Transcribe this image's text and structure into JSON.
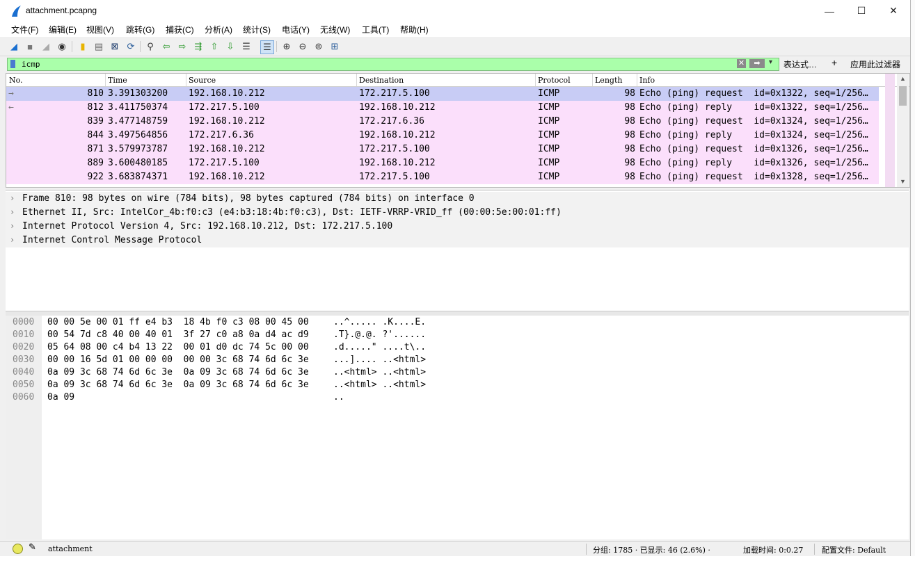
{
  "window": {
    "title": "attachment.pcapng",
    "minimize": "—",
    "maximize": "☐",
    "close": "✕"
  },
  "menu": [
    "文件(F)",
    "编辑(E)",
    "视图(V)",
    "跳转(G)",
    "捕获(C)",
    "分析(A)",
    "统计(S)",
    "电话(Y)",
    "无线(W)",
    "工具(T)",
    "帮助(H)"
  ],
  "filter": {
    "value": "icmp",
    "expression_label": "表达式…",
    "plus": "+",
    "apply_label": "应用此过滤器"
  },
  "columns": [
    "No.",
    "Time",
    "Source",
    "Destination",
    "Protocol",
    "Length",
    "Info"
  ],
  "packets": [
    {
      "no": "810",
      "time": "3.391303200",
      "src": "192.168.10.212",
      "dst": "172.217.5.100",
      "proto": "ICMP",
      "len": "98",
      "info": "Echo (ping) request  id=0x1322, seq=1/256…",
      "selected": true,
      "dir": "→"
    },
    {
      "no": "812",
      "time": "3.411750374",
      "src": "172.217.5.100",
      "dst": "192.168.10.212",
      "proto": "ICMP",
      "len": "98",
      "info": "Echo (ping) reply    id=0x1322, seq=1/256…",
      "selected": false,
      "dir": "←"
    },
    {
      "no": "839",
      "time": "3.477148759",
      "src": "192.168.10.212",
      "dst": "172.217.6.36",
      "proto": "ICMP",
      "len": "98",
      "info": "Echo (ping) request  id=0x1324, seq=1/256…",
      "selected": false,
      "dir": ""
    },
    {
      "no": "844",
      "time": "3.497564856",
      "src": "172.217.6.36",
      "dst": "192.168.10.212",
      "proto": "ICMP",
      "len": "98",
      "info": "Echo (ping) reply    id=0x1324, seq=1/256…",
      "selected": false,
      "dir": ""
    },
    {
      "no": "871",
      "time": "3.579973787",
      "src": "192.168.10.212",
      "dst": "172.217.5.100",
      "proto": "ICMP",
      "len": "98",
      "info": "Echo (ping) request  id=0x1326, seq=1/256…",
      "selected": false,
      "dir": ""
    },
    {
      "no": "889",
      "time": "3.600480185",
      "src": "172.217.5.100",
      "dst": "192.168.10.212",
      "proto": "ICMP",
      "len": "98",
      "info": "Echo (ping) reply    id=0x1326, seq=1/256…",
      "selected": false,
      "dir": ""
    },
    {
      "no": "922",
      "time": "3.683874371",
      "src": "192.168.10.212",
      "dst": "172.217.5.100",
      "proto": "ICMP",
      "len": "98",
      "info": "Echo (ping) request  id=0x1328, seq=1/256…",
      "selected": false,
      "dir": ""
    }
  ],
  "details": [
    "Frame 810: 98 bytes on wire (784 bits), 98 bytes captured (784 bits) on interface 0",
    "Ethernet II, Src: IntelCor_4b:f0:c3 (e4:b3:18:4b:f0:c3), Dst: IETF-VRRP-VRID_ff (00:00:5e:00:01:ff)",
    "Internet Protocol Version 4, Src: 192.168.10.212, Dst: 172.217.5.100",
    "Internet Control Message Protocol"
  ],
  "bytes": [
    {
      "off": "0000",
      "hex": "00 00 5e 00 01 ff e4 b3  18 4b f0 c3 08 00 45 00",
      "ascii": "..^..... .K....E."
    },
    {
      "off": "0010",
      "hex": "00 54 7d c8 40 00 40 01  3f 27 c0 a8 0a d4 ac d9",
      "ascii": ".T}.@.@. ?'......"
    },
    {
      "off": "0020",
      "hex": "05 64 08 00 c4 b4 13 22  00 01 d0 dc 74 5c 00 00",
      "ascii": ".d.....\" ....t\\.."
    },
    {
      "off": "0030",
      "hex": "00 00 16 5d 01 00 00 00  00 00 3c 68 74 6d 6c 3e",
      "ascii": "...].... ..<html>"
    },
    {
      "off": "0040",
      "hex": "0a 09 3c 68 74 6d 6c 3e  0a 09 3c 68 74 6d 6c 3e",
      "ascii": "..<html> ..<html>"
    },
    {
      "off": "0050",
      "hex": "0a 09 3c 68 74 6d 6c 3e  0a 09 3c 68 74 6d 6c 3e",
      "ascii": "..<html> ..<html>"
    },
    {
      "off": "0060",
      "hex": "0a 09",
      "ascii": ".."
    }
  ],
  "status": {
    "file": "attachment",
    "packets": "分组: 1785 · 已显示: 46 (2.6%) ·",
    "load": "加载时间: 0:0.27",
    "profile": "配置文件: Default"
  },
  "colors": {
    "row_bg": "#fbdffb",
    "selected_bg": "#c8ccf5",
    "filter_ok": "#aaffaa"
  }
}
